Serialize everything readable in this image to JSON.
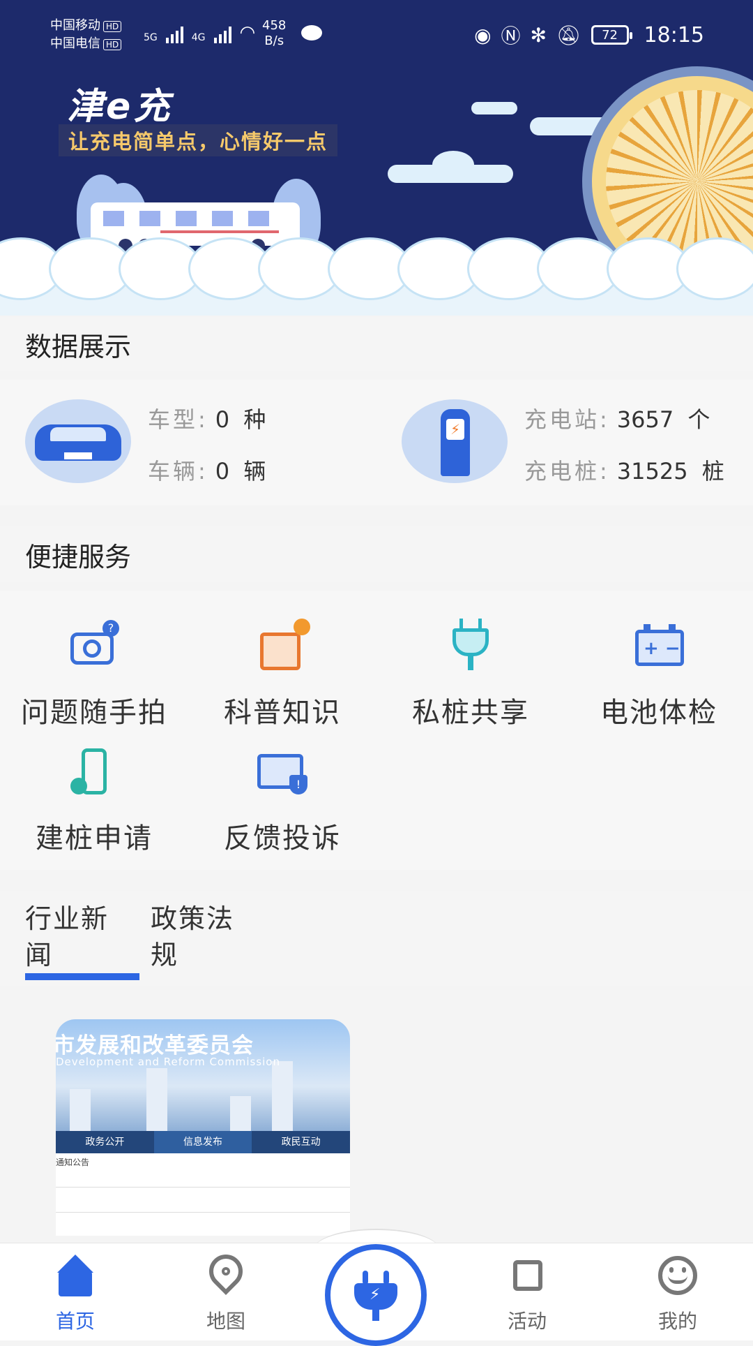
{
  "status_bar": {
    "carrier1": "中国移动",
    "carrier2": "中国电信",
    "hd": "HD",
    "net1": "5G",
    "net2": "4G",
    "speed_value": "458",
    "speed_unit": "B/s",
    "battery": "72",
    "time": "18:15"
  },
  "banner": {
    "app_name": "津e充",
    "slogan": "让充电简单点，心情好一点"
  },
  "data_display": {
    "title": "数据展示",
    "vehicle": {
      "model_label": "车型:",
      "model_value": "0",
      "model_unit": "种",
      "count_label": "车辆:",
      "count_value": "0",
      "count_unit": "辆"
    },
    "charging": {
      "station_label": "充电站:",
      "station_value": "3657",
      "station_unit": "个",
      "pile_label": "充电桩:",
      "pile_value": "31525",
      "pile_unit": "桩"
    }
  },
  "services": {
    "title": "便捷服务",
    "items": [
      {
        "label": "问题随手拍",
        "icon": "camera-question-icon"
      },
      {
        "label": "科普知识",
        "icon": "book-bulb-icon"
      },
      {
        "label": "私桩共享",
        "icon": "plug-icon"
      },
      {
        "label": "电池体检",
        "icon": "battery-check-icon"
      },
      {
        "label": "建桩申请",
        "icon": "charging-pile-apply-icon"
      },
      {
        "label": "反馈投诉",
        "icon": "mail-alert-icon"
      }
    ]
  },
  "news_tabs": [
    {
      "label": "行业新闻",
      "active": true
    },
    {
      "label": "政策法规",
      "active": false
    }
  ],
  "news_card": {
    "title": "市发展和改革委员会",
    "subtitle": "Development and Reform Commission",
    "nav": [
      "政务公开",
      "信息发布",
      "政民互动"
    ],
    "notice": "通知公告"
  },
  "bottom_nav": [
    {
      "label": "首页",
      "icon": "home-icon",
      "active": true
    },
    {
      "label": "地图",
      "icon": "map-pin-icon",
      "active": false
    },
    {
      "label": "",
      "icon": "charge-plug-icon",
      "active": false
    },
    {
      "label": "活动",
      "icon": "cube-icon",
      "active": false
    },
    {
      "label": "我的",
      "icon": "smiley-icon",
      "active": false
    }
  ],
  "colors": {
    "primary": "#2d66e3",
    "banner_bg": "#1d2a6b",
    "slogan": "#f6c96b"
  }
}
